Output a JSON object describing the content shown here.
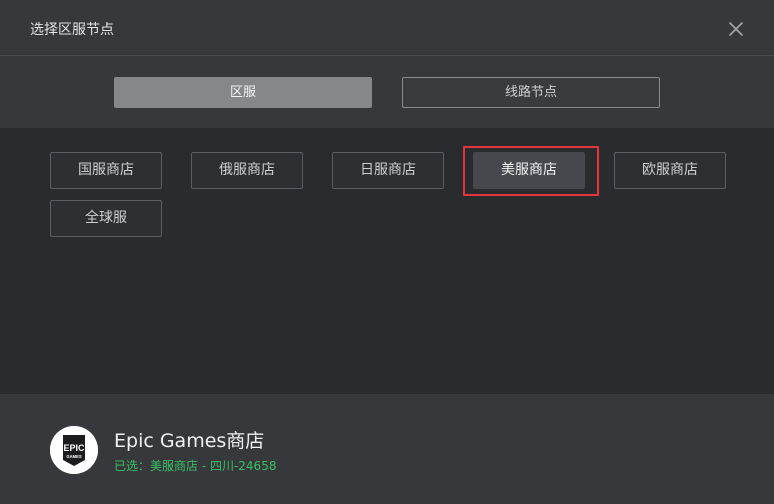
{
  "header": {
    "title": "选择区服节点",
    "close_icon": "close-icon"
  },
  "tabs": [
    {
      "label": "区服",
      "active": true
    },
    {
      "label": "线路节点",
      "active": false
    }
  ],
  "options": [
    {
      "label": "国服商店",
      "selected": false
    },
    {
      "label": "俄服商店",
      "selected": false
    },
    {
      "label": "日服商店",
      "selected": false
    },
    {
      "label": "美服商店",
      "selected": true
    },
    {
      "label": "欧服商店",
      "selected": false
    },
    {
      "label": "全球服",
      "selected": false
    }
  ],
  "footer": {
    "logo_icon": "epic-games-logo-icon",
    "logo_text_top": "EPIC",
    "logo_text_bottom": "GAMES",
    "game_title": "Epic Games商店",
    "selected_info": "已选：美服商店 - 四川-24658"
  },
  "colors": {
    "highlight": "#e5353a",
    "selected_info": "#37c263"
  }
}
